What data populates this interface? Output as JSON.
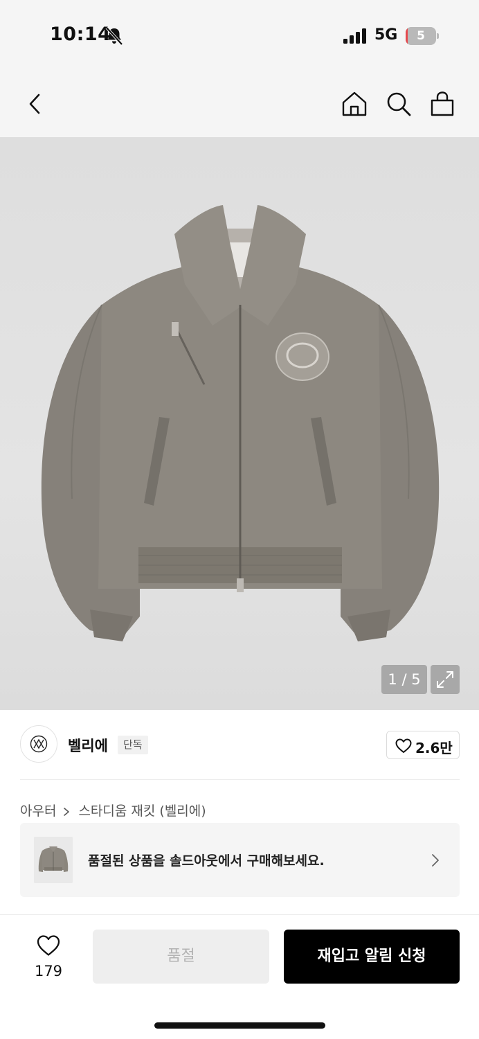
{
  "status_bar": {
    "time": "10:14",
    "network": "5G",
    "battery_level": "5",
    "battery_fraction": 0.05,
    "icons": [
      "bell-off-icon",
      "cellular-signal-icon",
      "battery-icon"
    ]
  },
  "nav": {
    "icons": [
      "back-chevron-icon",
      "home-icon",
      "search-icon",
      "shopping-bag-icon"
    ]
  },
  "gallery": {
    "counter": "1 / 5",
    "expand_icon": "expand-icon",
    "colors": {
      "jacket": "#8a857c",
      "background": "#e0e0e0"
    }
  },
  "brand": {
    "name": "벨리에",
    "badge": "단독",
    "likes": "2.6만",
    "icon": "heart-outline-icon"
  },
  "breadcrumb": {
    "category": "아우터",
    "product": "스타디움 재킷 (벨리에)"
  },
  "soldout_banner": {
    "text": "품절된 상품을 솔드아웃에서 구매해보세요."
  },
  "bottom_bar": {
    "wish_count": "179",
    "soldout_label": "품절",
    "restock_label": "재입고 알림 신청"
  }
}
